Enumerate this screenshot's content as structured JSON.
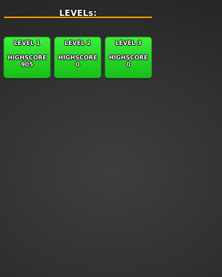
{
  "header": {
    "title": "LEVELs:"
  },
  "colors": {
    "divider": "#ff9f00",
    "card_green": "#2ad82a",
    "background": "#313131"
  },
  "levels": [
    {
      "name": "LEVEL 1",
      "highscore_label": "HIGHSCORE",
      "highscore": "905"
    },
    {
      "name": "LEVEL 2",
      "highscore_label": "HIGHSCORE",
      "highscore": "0"
    },
    {
      "name": "LEVEL 3",
      "highscore_label": "HIGHSCORE",
      "highscore": "0"
    }
  ]
}
